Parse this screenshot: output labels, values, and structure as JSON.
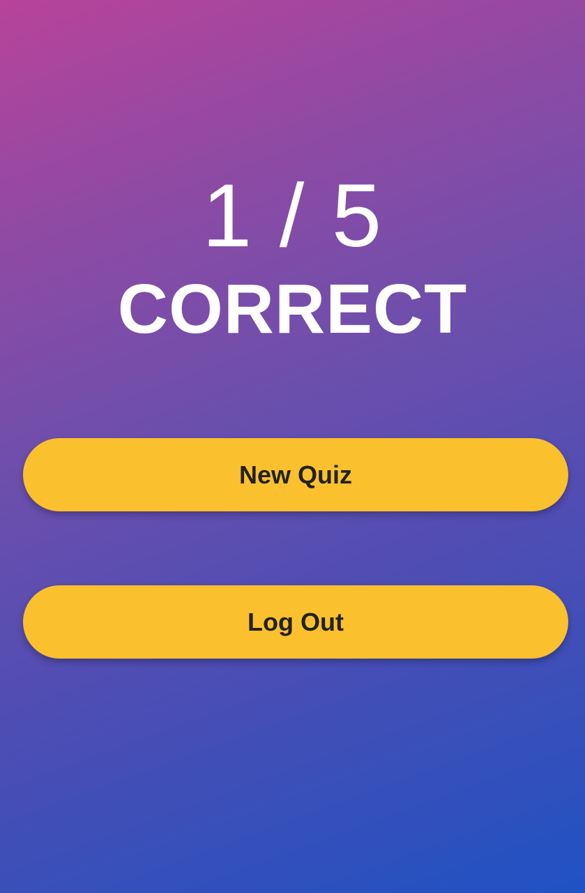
{
  "result": {
    "score_text": "1 / 5",
    "correct": 1,
    "total": 5,
    "label": "CORRECT"
  },
  "actions": {
    "new_quiz_label": "New Quiz",
    "log_out_label": "Log Out"
  },
  "colors": {
    "gradient_start": "#b8439a",
    "gradient_end": "#1f52c4",
    "button_bg": "#fbc02d",
    "button_text": "#222222",
    "heading_text": "#ffffff"
  }
}
